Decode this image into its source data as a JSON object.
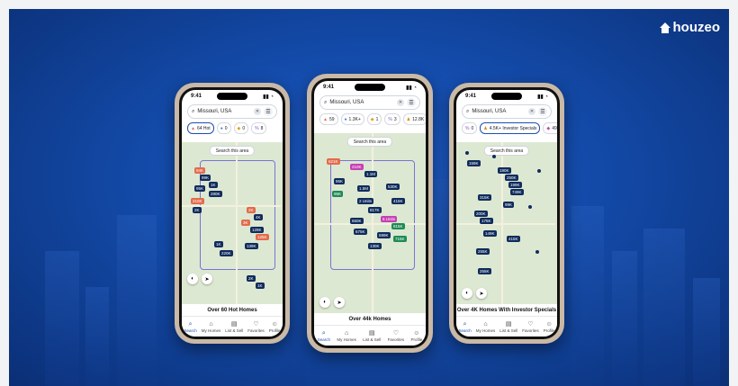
{
  "brand": {
    "name": "houzeo"
  },
  "status_time": "9:41",
  "phones": [
    {
      "search_text": "Missouri, USA",
      "chips": [
        {
          "icon": "fire-icon",
          "label": "64 Hot",
          "active": true
        },
        {
          "icon": "pin-icon",
          "label": "0"
        },
        {
          "icon": "tag-icon",
          "label": "0"
        },
        {
          "icon": "percent-icon",
          "label": "8"
        },
        {
          "icon": "person-icon",
          "label": ""
        }
      ],
      "search_area": "Search this area",
      "pins": [
        "94K",
        "99K",
        "1K",
        "95K",
        "280K",
        "210K",
        "2K",
        "2K",
        "4K",
        "3K",
        "129K",
        "125K",
        "1K",
        "220K",
        "139K",
        "210K",
        "159K",
        "115K",
        "2K",
        "1K",
        "3K"
      ],
      "sheet_title": "Over 60 Hot Homes",
      "tabs": [
        "Search",
        "My Homes",
        "List & Sell",
        "Favorites",
        "Profile"
      ]
    },
    {
      "search_text": "Missouri, USA",
      "chips": [
        {
          "icon": "fire-icon",
          "label": "59"
        },
        {
          "icon": "pin-icon",
          "label": "1.3K+"
        },
        {
          "icon": "tag-icon",
          "label": "1"
        },
        {
          "icon": "percent-icon",
          "label": "3"
        },
        {
          "icon": "person-icon",
          "label": "12.8K"
        }
      ],
      "search_area": "Search this area",
      "pins": [
        "621K",
        "210K",
        "1.1M",
        "95K",
        "1.5M",
        "530K",
        "95K",
        "2 Units",
        "415K",
        "1.2M",
        "330K",
        "817K",
        "650K",
        "750K",
        "6 Units",
        "815K",
        "675K",
        "599K",
        "1.2M",
        "650K",
        "715K",
        "130K",
        "900K"
      ],
      "sheet_title": "Over 44k Homes",
      "tabs": [
        "Search",
        "My Homes",
        "List & Sell",
        "Favorites",
        "Profile"
      ]
    },
    {
      "search_text": "Missouri, USA",
      "chips": [
        {
          "icon": "percent-icon",
          "label": "0"
        },
        {
          "icon": "person-icon",
          "label": "4.5K+ Investor Specials",
          "active": true
        },
        {
          "icon": "tag-icon",
          "label": "490"
        }
      ],
      "search_area": "Search this area",
      "pins": [
        "159K",
        "190K",
        "145K",
        "250K",
        "160K",
        "199K",
        "749K",
        "60K",
        "315K",
        "99K",
        "200K",
        "45K",
        "175K",
        "250K",
        "159K",
        "149K",
        "150K",
        "255K",
        "415K",
        "255K"
      ],
      "sheet_title": "Over 4K Homes With Investor Specials",
      "tabs": [
        "Search",
        "My Homes",
        "List & Sell",
        "Favorites",
        "Profile"
      ]
    }
  ]
}
